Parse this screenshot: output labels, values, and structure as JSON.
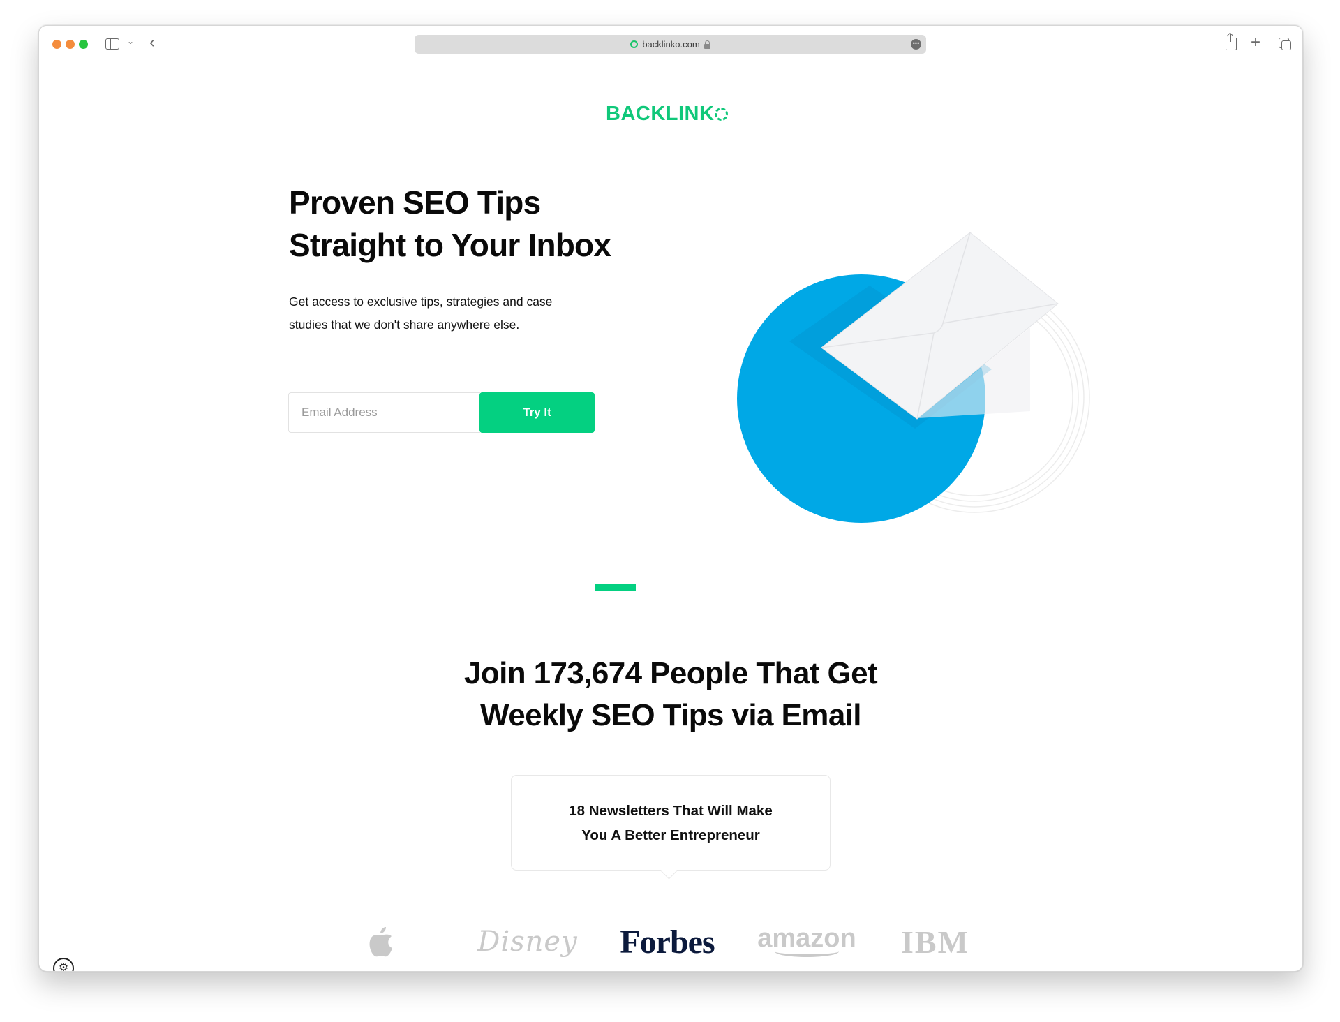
{
  "browser": {
    "url": "backlinko.com",
    "controls": {
      "close": "close-window",
      "minimize": "minimize-window",
      "maximize": "maximize-window"
    },
    "icons": {
      "sidebar": "sidebar-icon",
      "chevron": "chevron-down-icon",
      "back": "back-icon",
      "more": "more-icon",
      "share": "share-icon",
      "new_tab": "plus-icon",
      "tabs": "tabs-overview-icon"
    },
    "chevron_glyph": "⌄",
    "back_glyph": "‹",
    "more_glyph": "•••",
    "plus_glyph": "+"
  },
  "site": {
    "logo_text": "BACKLINK",
    "brand_color": "#04d081"
  },
  "hero": {
    "title_line1": "Proven SEO Tips",
    "title_line2": "Straight to Your Inbox",
    "subtitle_line1": "Get access to exclusive tips, strategies and case",
    "subtitle_line2": "studies that we don't share anywhere else.",
    "email_placeholder": "Email Address",
    "email_value": "",
    "cta_label": "Try It",
    "illustration": "envelope-over-blue-circle"
  },
  "social_proof": {
    "title_line1": "Join 173,674 People That Get",
    "title_line2": "Weekly SEO Tips via Email",
    "subscriber_count": "173,674",
    "callout_line1": "18 Newsletters That Will Make",
    "callout_line2": "You A Better Entrepreneur",
    "logos": [
      {
        "name": "Apple",
        "glyph": ""
      },
      {
        "name": "Disney",
        "glyph": "Disney"
      },
      {
        "name": "Forbes",
        "glyph": "Forbes"
      },
      {
        "name": "amazon",
        "glyph": "amazon"
      },
      {
        "name": "IBM",
        "glyph": "IBM"
      }
    ]
  },
  "settings": {
    "glyph": "⚙"
  }
}
